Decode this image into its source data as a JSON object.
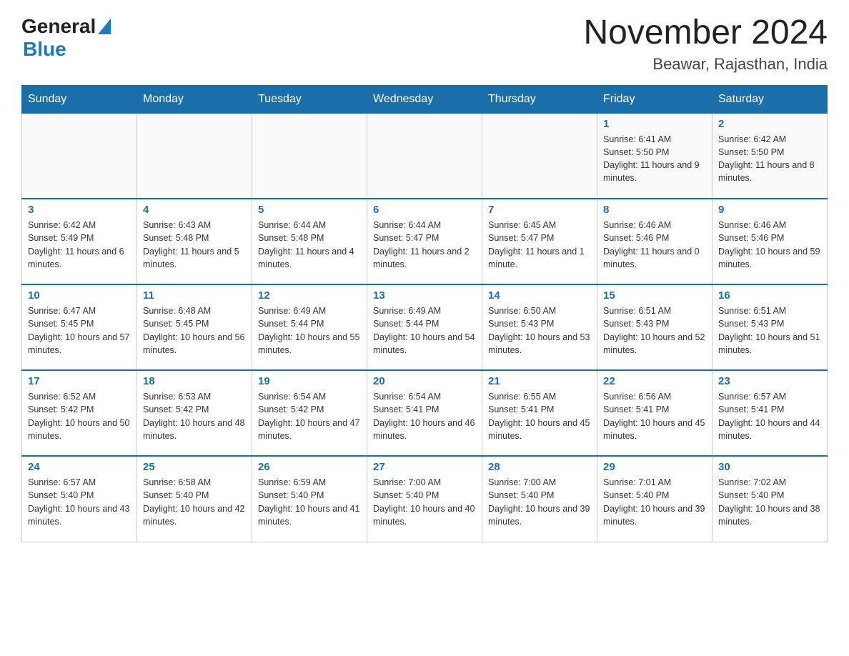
{
  "header": {
    "logo_general": "General",
    "logo_blue": "Blue",
    "month_year": "November 2024",
    "location": "Beawar, Rajasthan, India"
  },
  "weekdays": [
    "Sunday",
    "Monday",
    "Tuesday",
    "Wednesday",
    "Thursday",
    "Friday",
    "Saturday"
  ],
  "weeks": [
    [
      {
        "day": "",
        "info": ""
      },
      {
        "day": "",
        "info": ""
      },
      {
        "day": "",
        "info": ""
      },
      {
        "day": "",
        "info": ""
      },
      {
        "day": "",
        "info": ""
      },
      {
        "day": "1",
        "info": "Sunrise: 6:41 AM\nSunset: 5:50 PM\nDaylight: 11 hours and 9 minutes."
      },
      {
        "day": "2",
        "info": "Sunrise: 6:42 AM\nSunset: 5:50 PM\nDaylight: 11 hours and 8 minutes."
      }
    ],
    [
      {
        "day": "3",
        "info": "Sunrise: 6:42 AM\nSunset: 5:49 PM\nDaylight: 11 hours and 6 minutes."
      },
      {
        "day": "4",
        "info": "Sunrise: 6:43 AM\nSunset: 5:48 PM\nDaylight: 11 hours and 5 minutes."
      },
      {
        "day": "5",
        "info": "Sunrise: 6:44 AM\nSunset: 5:48 PM\nDaylight: 11 hours and 4 minutes."
      },
      {
        "day": "6",
        "info": "Sunrise: 6:44 AM\nSunset: 5:47 PM\nDaylight: 11 hours and 2 minutes."
      },
      {
        "day": "7",
        "info": "Sunrise: 6:45 AM\nSunset: 5:47 PM\nDaylight: 11 hours and 1 minute."
      },
      {
        "day": "8",
        "info": "Sunrise: 6:46 AM\nSunset: 5:46 PM\nDaylight: 11 hours and 0 minutes."
      },
      {
        "day": "9",
        "info": "Sunrise: 6:46 AM\nSunset: 5:46 PM\nDaylight: 10 hours and 59 minutes."
      }
    ],
    [
      {
        "day": "10",
        "info": "Sunrise: 6:47 AM\nSunset: 5:45 PM\nDaylight: 10 hours and 57 minutes."
      },
      {
        "day": "11",
        "info": "Sunrise: 6:48 AM\nSunset: 5:45 PM\nDaylight: 10 hours and 56 minutes."
      },
      {
        "day": "12",
        "info": "Sunrise: 6:49 AM\nSunset: 5:44 PM\nDaylight: 10 hours and 55 minutes."
      },
      {
        "day": "13",
        "info": "Sunrise: 6:49 AM\nSunset: 5:44 PM\nDaylight: 10 hours and 54 minutes."
      },
      {
        "day": "14",
        "info": "Sunrise: 6:50 AM\nSunset: 5:43 PM\nDaylight: 10 hours and 53 minutes."
      },
      {
        "day": "15",
        "info": "Sunrise: 6:51 AM\nSunset: 5:43 PM\nDaylight: 10 hours and 52 minutes."
      },
      {
        "day": "16",
        "info": "Sunrise: 6:51 AM\nSunset: 5:43 PM\nDaylight: 10 hours and 51 minutes."
      }
    ],
    [
      {
        "day": "17",
        "info": "Sunrise: 6:52 AM\nSunset: 5:42 PM\nDaylight: 10 hours and 50 minutes."
      },
      {
        "day": "18",
        "info": "Sunrise: 6:53 AM\nSunset: 5:42 PM\nDaylight: 10 hours and 48 minutes."
      },
      {
        "day": "19",
        "info": "Sunrise: 6:54 AM\nSunset: 5:42 PM\nDaylight: 10 hours and 47 minutes."
      },
      {
        "day": "20",
        "info": "Sunrise: 6:54 AM\nSunset: 5:41 PM\nDaylight: 10 hours and 46 minutes."
      },
      {
        "day": "21",
        "info": "Sunrise: 6:55 AM\nSunset: 5:41 PM\nDaylight: 10 hours and 45 minutes."
      },
      {
        "day": "22",
        "info": "Sunrise: 6:56 AM\nSunset: 5:41 PM\nDaylight: 10 hours and 45 minutes."
      },
      {
        "day": "23",
        "info": "Sunrise: 6:57 AM\nSunset: 5:41 PM\nDaylight: 10 hours and 44 minutes."
      }
    ],
    [
      {
        "day": "24",
        "info": "Sunrise: 6:57 AM\nSunset: 5:40 PM\nDaylight: 10 hours and 43 minutes."
      },
      {
        "day": "25",
        "info": "Sunrise: 6:58 AM\nSunset: 5:40 PM\nDaylight: 10 hours and 42 minutes."
      },
      {
        "day": "26",
        "info": "Sunrise: 6:59 AM\nSunset: 5:40 PM\nDaylight: 10 hours and 41 minutes."
      },
      {
        "day": "27",
        "info": "Sunrise: 7:00 AM\nSunset: 5:40 PM\nDaylight: 10 hours and 40 minutes."
      },
      {
        "day": "28",
        "info": "Sunrise: 7:00 AM\nSunset: 5:40 PM\nDaylight: 10 hours and 39 minutes."
      },
      {
        "day": "29",
        "info": "Sunrise: 7:01 AM\nSunset: 5:40 PM\nDaylight: 10 hours and 39 minutes."
      },
      {
        "day": "30",
        "info": "Sunrise: 7:02 AM\nSunset: 5:40 PM\nDaylight: 10 hours and 38 minutes."
      }
    ]
  ]
}
